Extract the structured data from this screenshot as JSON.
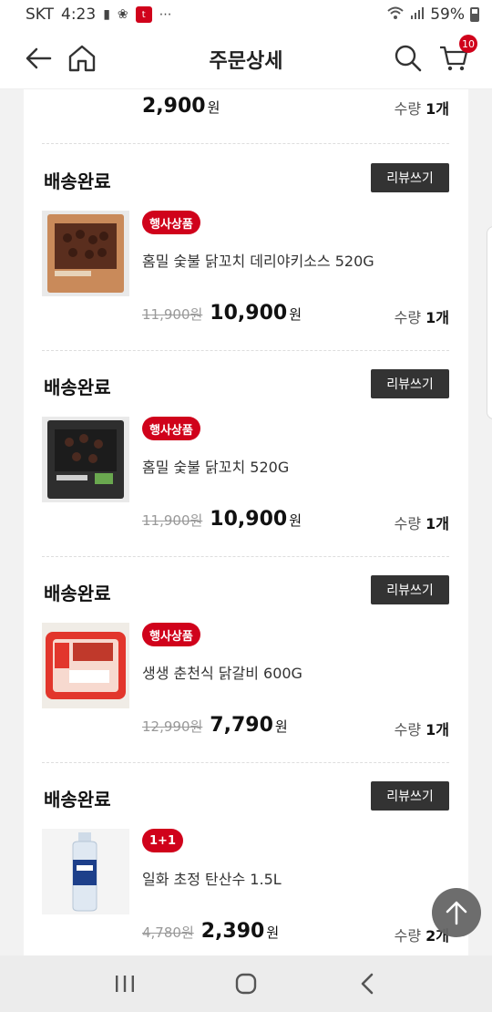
{
  "status_bar": {
    "carrier": "SKT",
    "time": "4:23",
    "battery": "59%",
    "app_badge": "t"
  },
  "header": {
    "title": "주문상세",
    "cart_count": "10"
  },
  "top_item": {
    "sale_price": "2,900",
    "currency": "원",
    "qty_label": "수량",
    "qty_value": "1개"
  },
  "items": [
    {
      "status": "배송완료",
      "review_label": "리뷰쓰기",
      "badge": "행사상품",
      "name": "홈밀 숯불 닭꼬치 데리야키소스 520G",
      "orig_price": "11,900원",
      "sale_price": "10,900",
      "currency": "원",
      "qty_label": "수량",
      "qty_value": "1개",
      "thumb_color": "#c98a5a"
    },
    {
      "status": "배송완료",
      "review_label": "리뷰쓰기",
      "badge": "행사상품",
      "name": "홈밀 숯불 닭꼬치 520G",
      "orig_price": "11,900원",
      "sale_price": "10,900",
      "currency": "원",
      "qty_label": "수량",
      "qty_value": "1개",
      "thumb_color": "#3a3a3a"
    },
    {
      "status": "배송완료",
      "review_label": "리뷰쓰기",
      "badge": "행사상품",
      "name": "생생 춘천식 닭갈비 600G",
      "orig_price": "12,990원",
      "sale_price": "7,790",
      "currency": "원",
      "qty_label": "수량",
      "qty_value": "1개",
      "thumb_color": "#e2362c"
    },
    {
      "status": "배송완료",
      "review_label": "리뷰쓰기",
      "badge": "1+1",
      "name": "일화 초정 탄산수 1.5L",
      "orig_price": "4,780원",
      "sale_price": "2,390",
      "currency": "원",
      "qty_label": "수량",
      "qty_value": "2개",
      "thumb_color": "#dfe8f2"
    }
  ],
  "colors": {
    "accent": "#d0021b",
    "button_dark": "#333333"
  },
  "icons": {
    "back": "back-arrow-icon",
    "home": "home-icon",
    "search": "search-icon",
    "cart": "cart-icon",
    "scroll_top": "arrow-up-icon",
    "nav_recents": "recents-icon",
    "nav_home": "home-circle-icon",
    "nav_back": "chevron-left-icon"
  }
}
